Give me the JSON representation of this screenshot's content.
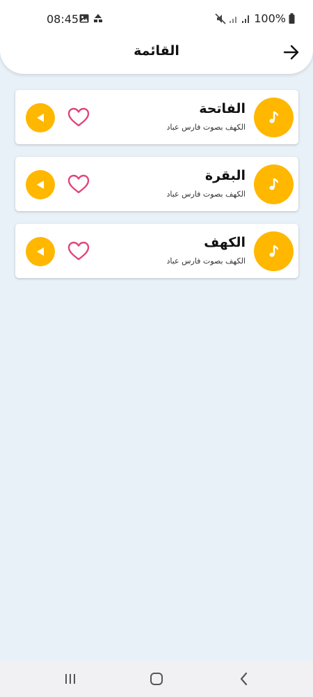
{
  "status_bar": {
    "time": "08:45",
    "battery_text": "100%",
    "icons": [
      "gallery-icon",
      "mm-icon",
      "mute-icon",
      "signal-icon",
      "signal-icon",
      "battery-icon"
    ]
  },
  "header": {
    "title": "القائمة",
    "back_icon": "arrow-right-icon"
  },
  "tracks": [
    {
      "title": "الفاتحة",
      "subtitle": "الكهف بصوت فارس عباد"
    },
    {
      "title": "البقرة",
      "subtitle": "الكهف بصوت فارس عباد"
    },
    {
      "title": "الكهف",
      "subtitle": "الكهف بصوت فارس عباد"
    }
  ],
  "colors": {
    "accent": "#ffb700",
    "heart": "#e0457b",
    "background": "#e9f1f8"
  },
  "navbar": {
    "icons": [
      "recent-apps-icon",
      "home-icon",
      "back-icon"
    ]
  }
}
